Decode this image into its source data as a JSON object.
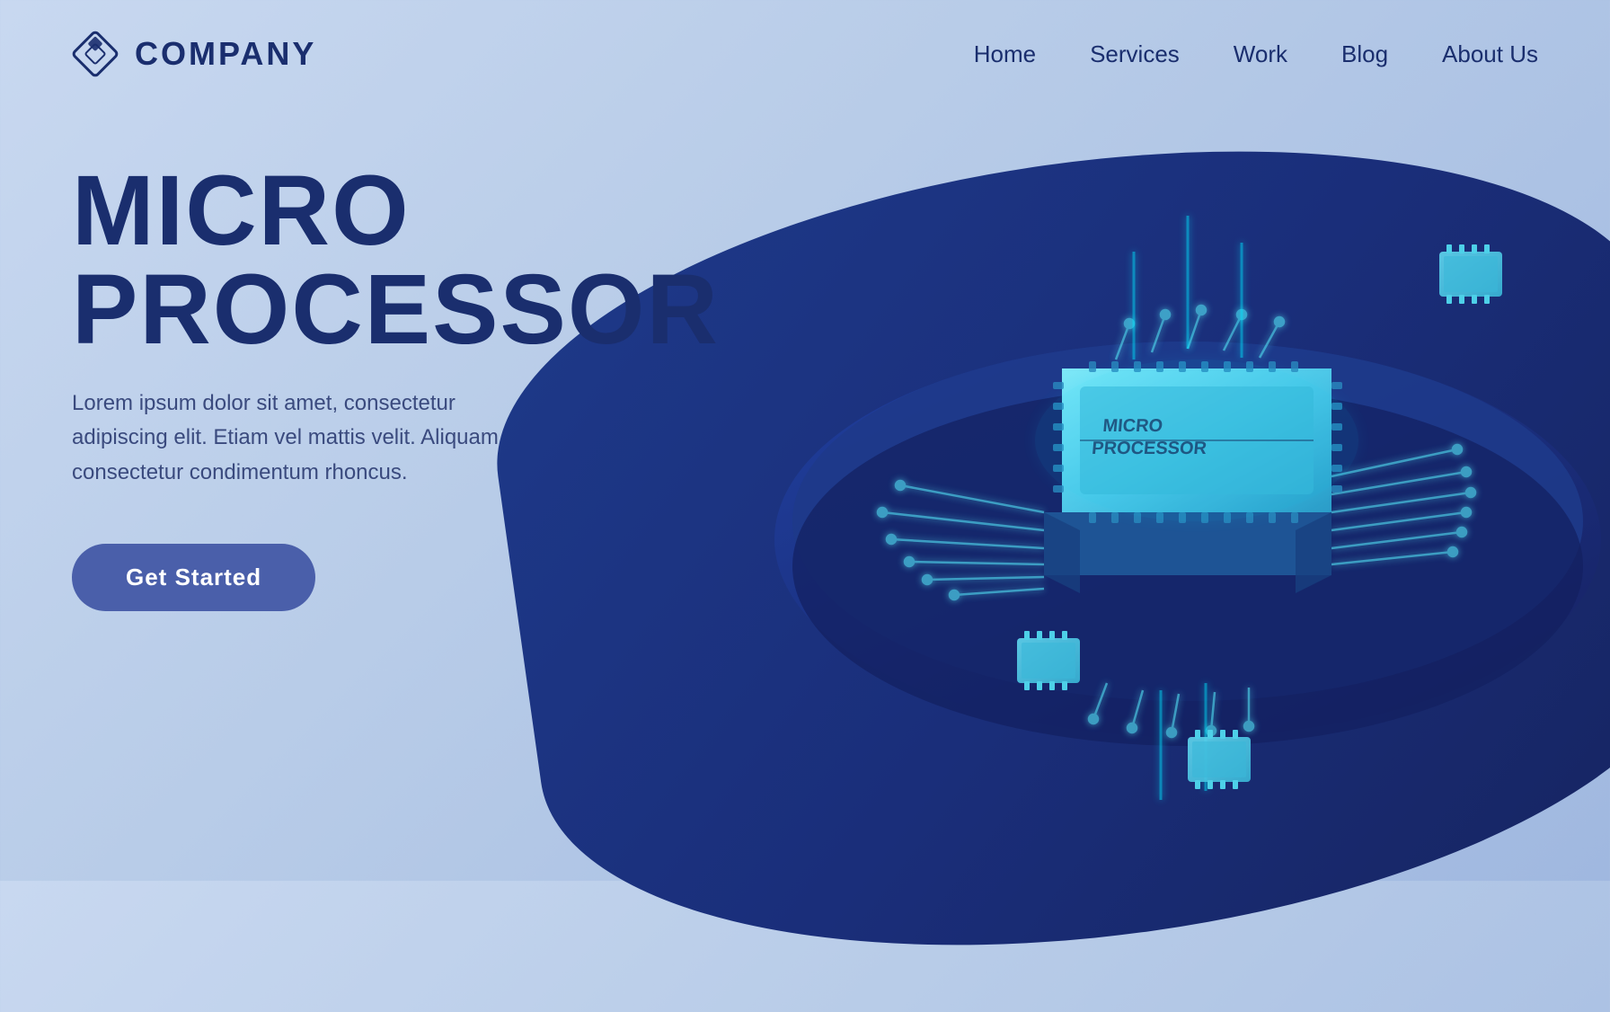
{
  "navbar": {
    "logo_text": "COMPANY",
    "nav_items": [
      {
        "label": "Home",
        "id": "home"
      },
      {
        "label": "Services",
        "id": "services"
      },
      {
        "label": "Work",
        "id": "work"
      },
      {
        "label": "Blog",
        "id": "blog"
      },
      {
        "label": "About Us",
        "id": "about"
      }
    ]
  },
  "hero": {
    "title_line1": "MICRO",
    "title_line2": "PROCESSOR",
    "description": "Lorem ipsum dolor sit amet, consectetur adipiscing elit. Etiam vel mattis velit. Aliquam consectetur condimentum rhoncus.",
    "cta_label": "Get Started"
  },
  "colors": {
    "background_start": "#c8d8f0",
    "background_end": "#a0b8e0",
    "blob_dark": "#1a2e7a",
    "text_dark": "#1a2e6e",
    "btn_bg": "#4a5faa",
    "circuit_line": "#4dd0e8",
    "cpu_top": "#5bc8e8",
    "accent_glow": "#00e5ff"
  }
}
